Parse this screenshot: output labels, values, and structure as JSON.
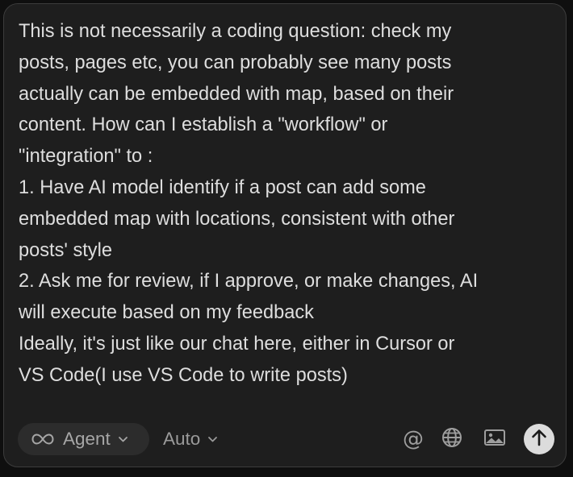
{
  "composer": {
    "message_lines": [
      "This is not necessarily a coding question: check my",
      "posts, pages etc, you can probably see many posts",
      "actually can be embedded with map, based on their",
      "content. How can I establish a \"workflow\" or",
      "\"integration\" to :",
      "1. Have AI model identify if a post can add some",
      "embedded map with locations, consistent with other",
      "posts' style",
      "2. Ask me for review, if I approve, or make changes, AI",
      "will execute based on my feedback",
      "Ideally, it's just like our chat here, either in Cursor or",
      "VS Code(I use VS Code to write posts)"
    ]
  },
  "toolbar": {
    "mode_label": "Agent",
    "mode_icon": "infinity-icon",
    "model_label": "Auto",
    "mention_glyph": "@",
    "web_icon": "globe-icon",
    "image_icon": "image-icon",
    "send_icon": "arrow-up-icon"
  },
  "colors": {
    "panel_background": "#1e1e1e",
    "panel_border": "#3c3c3c",
    "text": "#dedede",
    "muted_text": "#a6a6a6",
    "send_button": "#dcdcdc"
  }
}
